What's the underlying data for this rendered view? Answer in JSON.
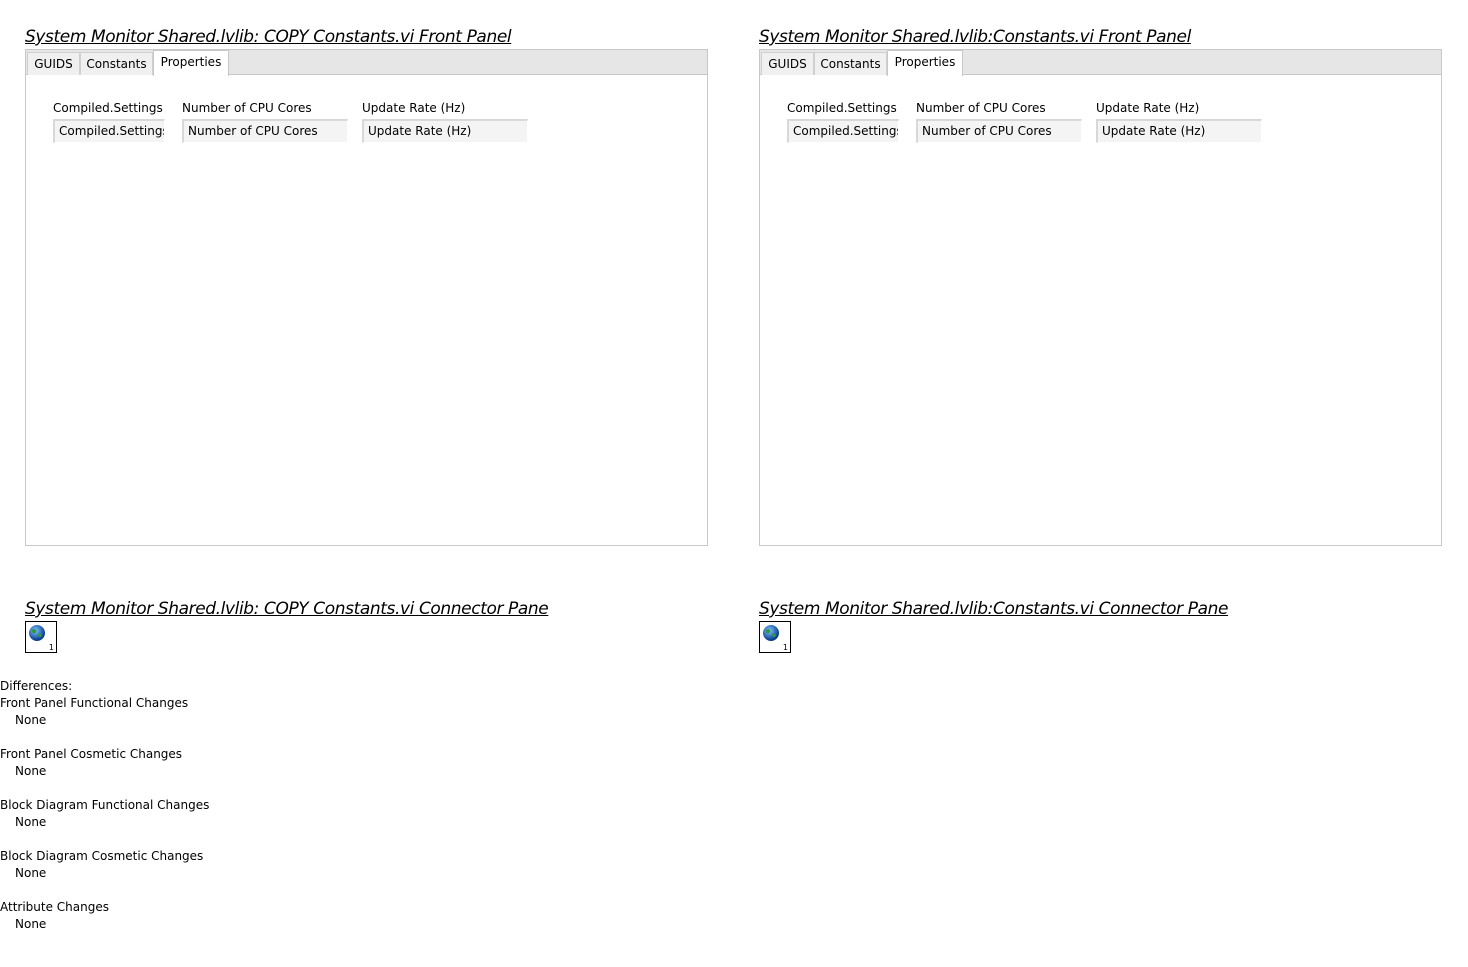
{
  "left": {
    "front_panel_title": "System Monitor Shared.lvlib:  COPY  Constants.vi Front Panel",
    "connector_title": "System Monitor Shared.lvlib:  COPY  Constants.vi Connector Pane",
    "tabs": [
      "GUIDS",
      "Constants",
      "Properties"
    ],
    "active_tab": "Properties",
    "controls": [
      {
        "label": "Compiled.Settings",
        "value": "Compiled.Settings"
      },
      {
        "label": "Number of CPU Cores",
        "value": "Number of CPU Cores"
      },
      {
        "label": "Update Rate (Hz)",
        "value": "Update Rate (Hz)"
      }
    ],
    "connector_number": "1",
    "connector_icon": "globe-icon"
  },
  "right": {
    "front_panel_title": "System Monitor Shared.lvlib:Constants.vi Front Panel",
    "connector_title": "System Monitor Shared.lvlib:Constants.vi Connector Pane",
    "tabs": [
      "GUIDS",
      "Constants",
      "Properties"
    ],
    "active_tab": "Properties",
    "controls": [
      {
        "label": "Compiled.Settings",
        "value": "Compiled.Settings"
      },
      {
        "label": "Number of CPU Cores",
        "value": "Number of CPU Cores"
      },
      {
        "label": "Update Rate (Hz)",
        "value": "Update Rate (Hz)"
      }
    ],
    "connector_number": "1",
    "connector_icon": "globe-icon"
  },
  "differences": {
    "heading": "Differences:",
    "items": [
      {
        "category": "Front Panel Functional Changes",
        "value": "None"
      },
      {
        "category": "Front Panel Cosmetic Changes",
        "value": "None"
      },
      {
        "category": "Block Diagram Functional Changes",
        "value": "None"
      },
      {
        "category": "Block Diagram Cosmetic Changes",
        "value": "None"
      },
      {
        "category": "Attribute Changes",
        "value": "None"
      }
    ]
  }
}
